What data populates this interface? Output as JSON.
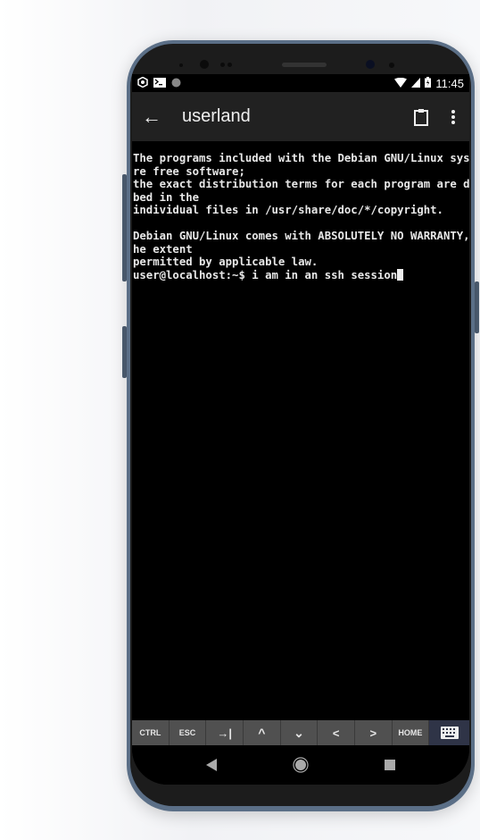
{
  "status_bar": {
    "time": "11:45",
    "left_icons": [
      "settings-hex-icon",
      "terminal-icon",
      "circle-icon"
    ],
    "right_icons": [
      "wifi-icon",
      "signal-icon",
      "battery-icon"
    ]
  },
  "app_bar": {
    "title": "userland",
    "back_icon": "arrow-left-icon",
    "clipboard_icon": "clipboard-icon",
    "menu_icon": "more-vert-icon"
  },
  "terminal": {
    "lines": [
      "The programs included with the Debian GNU/Linux system a",
      "re free software;",
      "the exact distribution terms for each program are descri",
      "bed in the",
      "individual files in /usr/share/doc/*/copyright.",
      "",
      "Debian GNU/Linux comes with ABSOLUTELY NO WARRANTY, to t",
      "he extent",
      "permitted by applicable law."
    ],
    "prompt": "user@localhost:~$ ",
    "input": "i am in an ssh session"
  },
  "extra_keys": [
    "CTRL",
    "ESC",
    "→|",
    "^",
    "⌄",
    "<",
    ">",
    "HOME"
  ],
  "colors": {
    "frame": "#5b6f87",
    "app_bar": "#212121",
    "keys": "#505050",
    "keyboard_key": "#2f3447"
  }
}
